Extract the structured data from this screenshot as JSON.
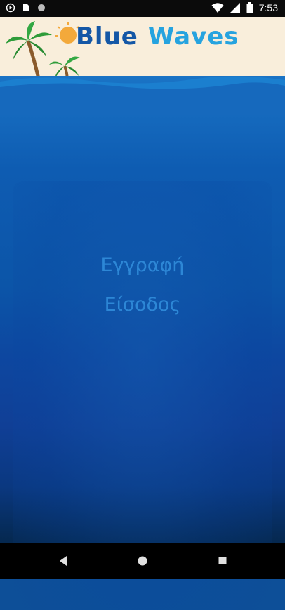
{
  "status_bar": {
    "time": "7:53",
    "left_icons": [
      "play-circle-icon",
      "sim-card-icon",
      "dot-icon"
    ],
    "right_icons": [
      "wifi-icon",
      "signal-icon",
      "battery-icon"
    ]
  },
  "header": {
    "title_part1": "Blue",
    "title_part2": "Waves",
    "logo_icon": "palm-trees-sun-icon"
  },
  "menu": {
    "register_label": "Εγγραφή",
    "login_label": "Είσοδος"
  },
  "nav_bar": {
    "icons": [
      "back-icon",
      "home-icon",
      "recents-icon"
    ]
  },
  "colors": {
    "header_bg": "#f9eedb",
    "title_dark_blue": "#1457a6",
    "title_light_blue": "#26a3df",
    "menu_text": "#2d87d6",
    "ocean": "#0d4f98"
  }
}
